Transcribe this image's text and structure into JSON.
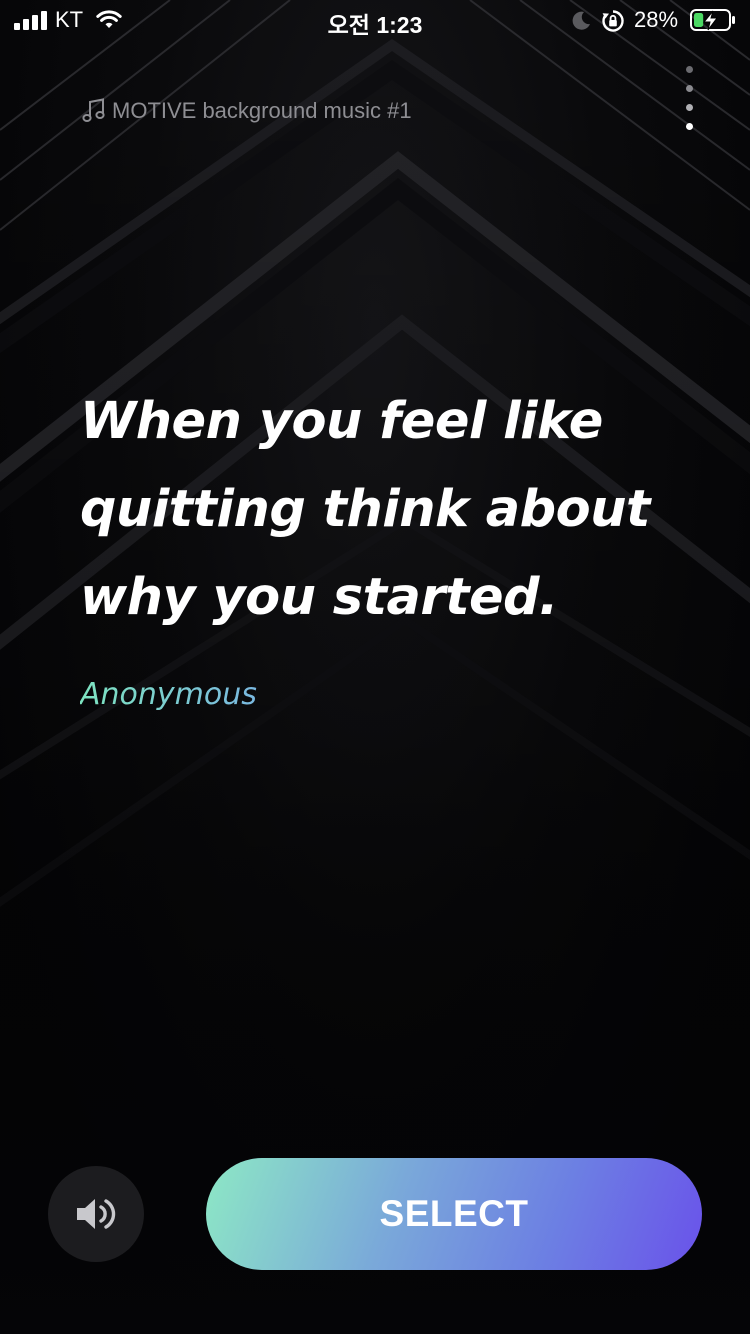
{
  "status_bar": {
    "carrier": "KT",
    "time": "오전 1:23",
    "battery_percent": "28%",
    "battery_level": 0.28,
    "charging": true
  },
  "header": {
    "music_icon": "music-note-icon",
    "music_title": "MOTIVE background music #1",
    "menu_icon": "more-vertical-icon"
  },
  "quote": {
    "text": "When you feel like quitting think about why you started.",
    "author": "Anonymous"
  },
  "controls": {
    "sound_icon": "speaker-icon",
    "select_label": "SELECT"
  },
  "colors": {
    "background": "#050507",
    "author_gradient": [
      "#7de3c0",
      "#7ab8e0"
    ],
    "select_gradient": [
      "#8de8c5",
      "#6a52ea"
    ],
    "sound_button": "#1c1c1f"
  }
}
